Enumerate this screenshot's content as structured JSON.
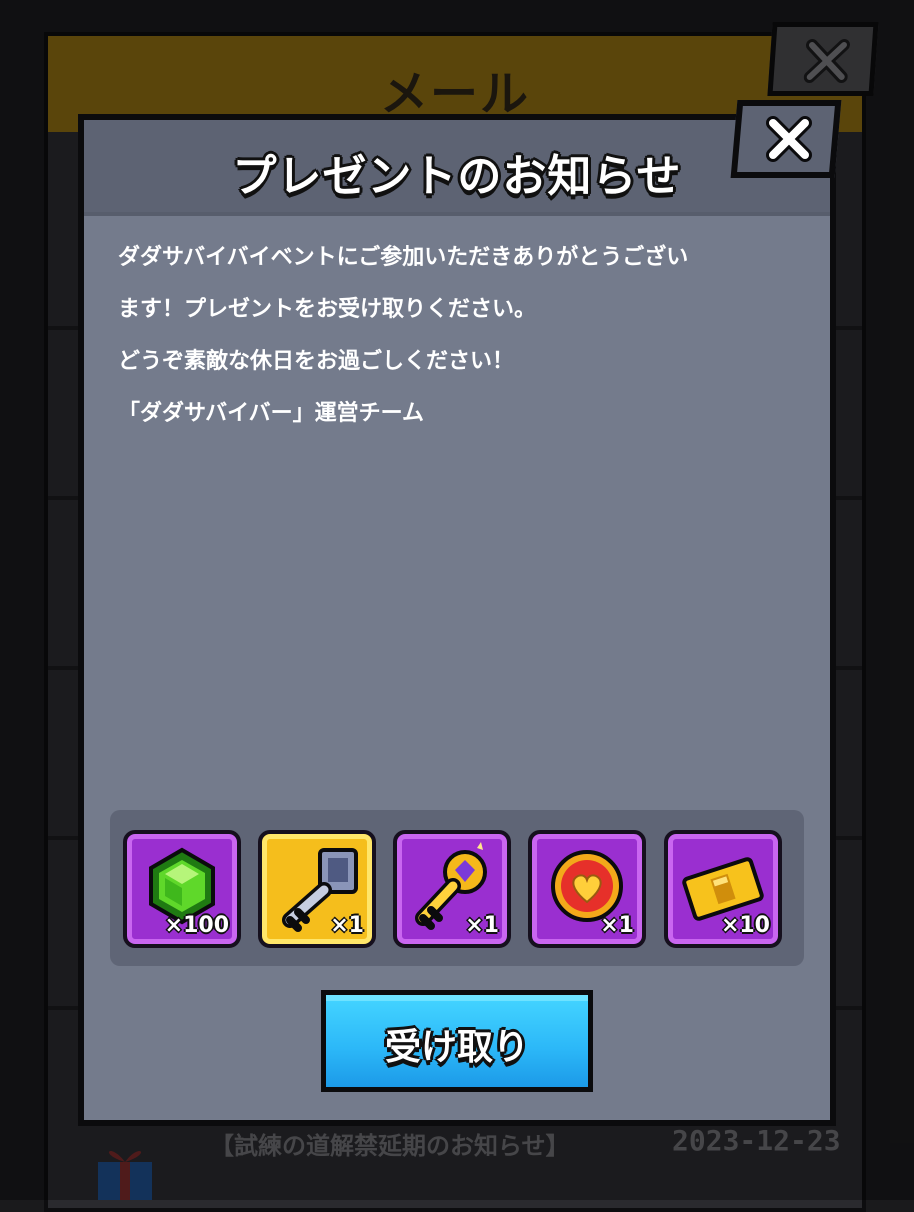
{
  "background": {
    "title": "メール",
    "mail_title": "【試練の道解禁延期のお知らせ】",
    "mail_date": "2023-12-23"
  },
  "dialog": {
    "title": "プレゼントのお知らせ",
    "message_lines": [
      "ダダサバイバイベントにご参加いただきありがとうござい",
      "ます！プレゼントをお受け取りください。",
      "どうぞ素敵な休日をお過ごしください！",
      "「ダダサバイバー」運営チーム"
    ],
    "rewards": [
      {
        "icon": "green-gem-icon",
        "qty": "×100"
      },
      {
        "icon": "silver-key-icon",
        "qty": "×1"
      },
      {
        "icon": "gold-key-icon",
        "qty": "×1"
      },
      {
        "icon": "heart-coin-icon",
        "qty": "×1"
      },
      {
        "icon": "gold-ticket-icon",
        "qty": "×10"
      }
    ],
    "receive_label": "受け取り"
  },
  "colors": {
    "dialog_body": "#747b8c",
    "dialog_header": "#5d6373",
    "item_purple": "#9a2fd0",
    "item_gold": "#f5be1c",
    "button_blue": "#2cb8f8"
  }
}
